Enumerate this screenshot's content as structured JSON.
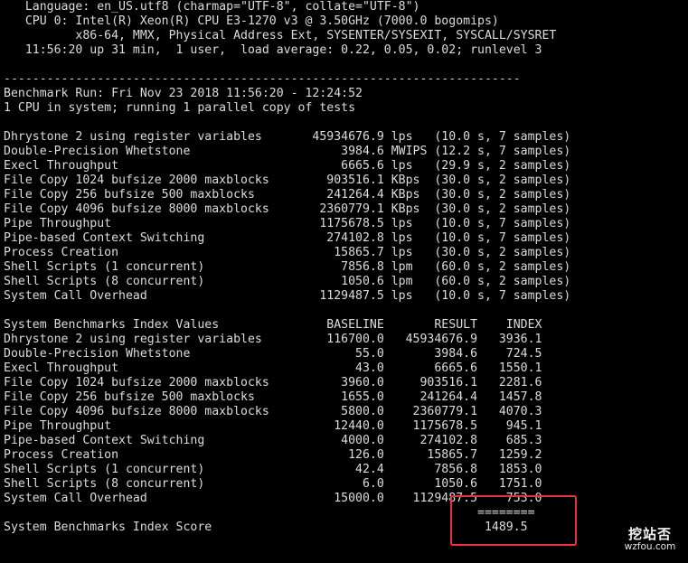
{
  "terminal": {
    "lines": [
      "   Language: en_US.utf8 (charmap=\"UTF-8\", collate=\"UTF-8\")",
      "   CPU 0: Intel(R) Xeon(R) CPU E3-1270 v3 @ 3.50GHz (7000.0 bogomips)",
      "          x86-64, MMX, Physical Address Ext, SYSENTER/SYSEXIT, SYSCALL/SYSRET",
      "   11:56:20 up 31 min,  1 user,  load average: 0.22, 0.05, 0.02; runlevel 3",
      "",
      "------------------------------------------------------------------------",
      "Benchmark Run: Fri Nov 23 2018 11:56:20 - 12:24:52",
      "1 CPU in system; running 1 parallel copy of tests",
      "",
      "Dhrystone 2 using register variables       45934676.9 lps   (10.0 s, 7 samples)",
      "Double-Precision Whetstone                     3984.6 MWIPS (12.2 s, 7 samples)",
      "Execl Throughput                               6665.6 lps   (29.9 s, 2 samples)",
      "File Copy 1024 bufsize 2000 maxblocks        903516.1 KBps  (30.0 s, 2 samples)",
      "File Copy 256 bufsize 500 maxblocks          241264.4 KBps  (30.0 s, 2 samples)",
      "File Copy 4096 bufsize 8000 maxblocks       2360779.1 KBps  (30.0 s, 2 samples)",
      "Pipe Throughput                             1175678.5 lps   (10.0 s, 7 samples)",
      "Pipe-based Context Switching                 274102.8 lps   (10.0 s, 7 samples)",
      "Process Creation                              15865.7 lps   (30.0 s, 2 samples)",
      "Shell Scripts (1 concurrent)                   7856.8 lpm   (60.0 s, 2 samples)",
      "Shell Scripts (8 concurrent)                   1050.6 lpm   (60.0 s, 2 samples)",
      "System Call Overhead                        1129487.5 lps   (10.0 s, 7 samples)",
      "",
      "System Benchmarks Index Values               BASELINE       RESULT    INDEX",
      "Dhrystone 2 using register variables         116700.0   45934676.9   3936.1",
      "Double-Precision Whetstone                       55.0       3984.6    724.5",
      "Execl Throughput                                 43.0       6665.6   1550.1",
      "File Copy 1024 bufsize 2000 maxblocks          3960.0     903516.1   2281.6",
      "File Copy 256 bufsize 500 maxblocks            1655.0     241264.4   1457.8",
      "File Copy 4096 bufsize 8000 maxblocks          5800.0    2360779.1   4070.3",
      "Pipe Throughput                               12440.0    1175678.5    945.1",
      "Pipe-based Context Switching                   4000.0     274102.8    685.3",
      "Process Creation                                126.0      15865.7   1259.2",
      "Shell Scripts (1 concurrent)                     42.4       7856.8   1853.0",
      "Shell Scripts (8 concurrent)                      6.0       1050.6   1751.0",
      "System Call Overhead                          15000.0    1129487.5    753.0",
      "                                                                  ========",
      "System Benchmarks Index Score                                      1489.5"
    ]
  },
  "watermark": {
    "logo": "挖站否",
    "url": "wzfou.com"
  },
  "colors": {
    "background": "#000000",
    "text": "#dcdcdc",
    "highlight_border": "#e8333a"
  }
}
